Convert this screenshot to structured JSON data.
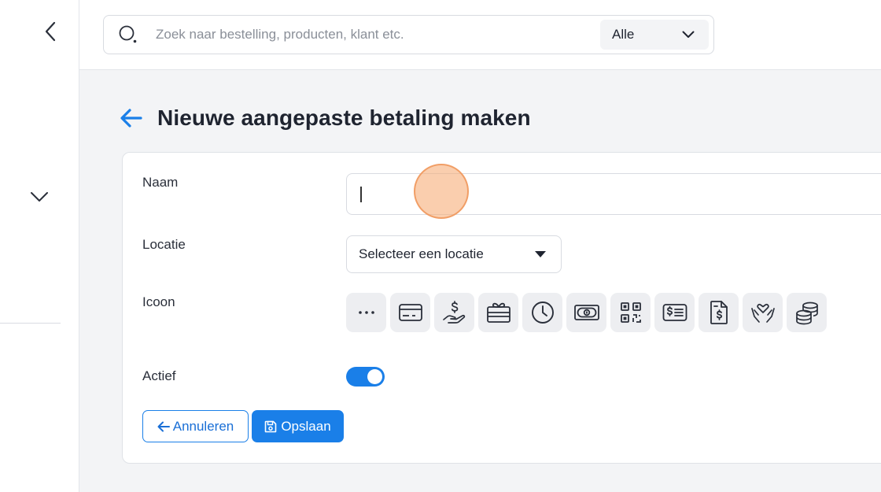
{
  "search": {
    "placeholder": "Zoek naar bestelling, producten, klant etc.",
    "scope_selected": "Alle"
  },
  "page": {
    "title": "Nieuwe aangepaste betaling maken"
  },
  "form": {
    "name_label": "Naam",
    "name_value": "",
    "location_label": "Locatie",
    "location_selected": "Selecteer een locatie",
    "icon_label": "Icoon",
    "icons": [
      "more-dots-icon",
      "credit-card-icon",
      "hand-dollar-icon",
      "gift-card-icon",
      "clock-icon",
      "banknote-icon",
      "qr-code-icon",
      "dollar-card-icon",
      "dollar-document-icon",
      "hand-heart-icon",
      "coins-icon"
    ],
    "active_label": "Actief",
    "active_on": true
  },
  "actions": {
    "cancel_label": "Annuleren",
    "save_label": "Opslaan"
  },
  "colors": {
    "accent": "#1a7fe8",
    "icon_bg": "#edeef1"
  }
}
